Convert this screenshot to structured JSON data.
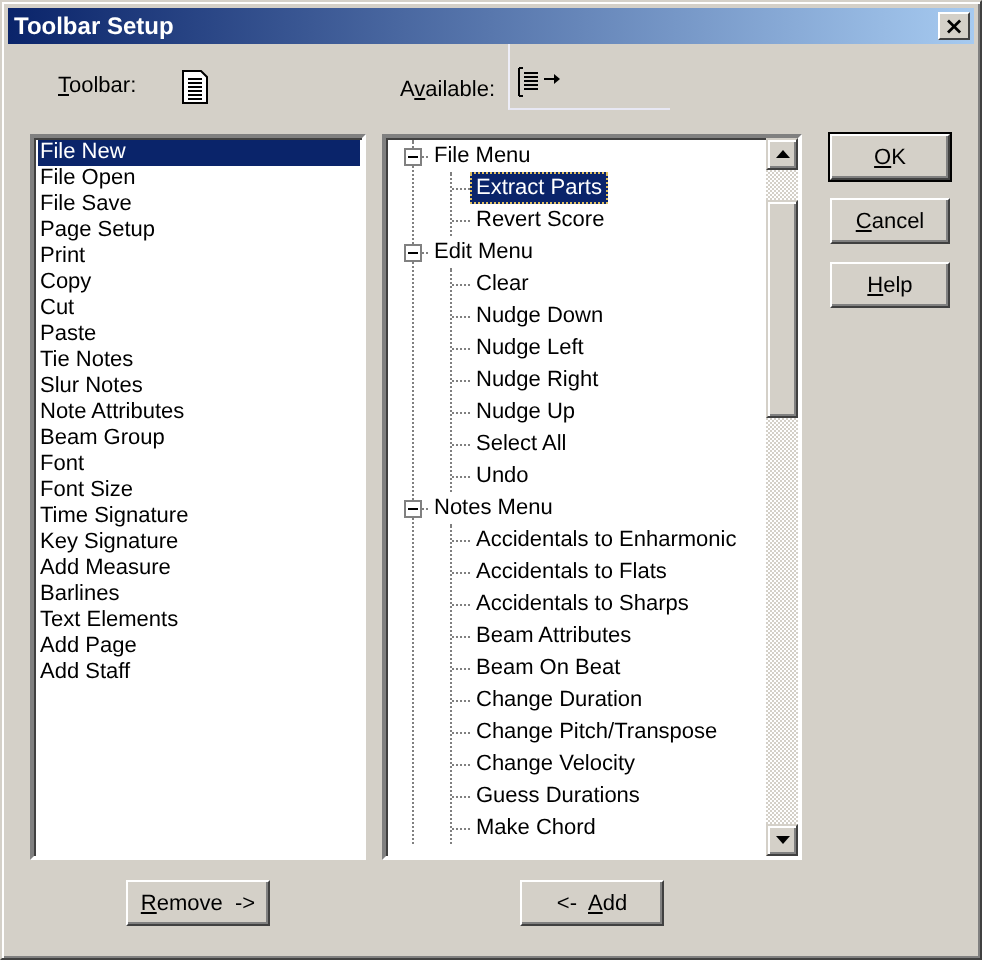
{
  "window": {
    "title": "Toolbar Setup",
    "close": "×"
  },
  "toolbar_label": {
    "key": "T",
    "post": "oolbar:"
  },
  "available_label": {
    "pre": "A",
    "key": "v",
    "post": "ailable:"
  },
  "toolbar_items": [
    {
      "label": "File New",
      "selected": true
    },
    {
      "label": "File Open",
      "selected": false
    },
    {
      "label": "File Save",
      "selected": false
    },
    {
      "label": "Page Setup",
      "selected": false
    },
    {
      "label": "Print",
      "selected": false
    },
    {
      "label": "Copy",
      "selected": false
    },
    {
      "label": "Cut",
      "selected": false
    },
    {
      "label": "Paste",
      "selected": false
    },
    {
      "label": "Tie Notes",
      "selected": false
    },
    {
      "label": "Slur Notes",
      "selected": false
    },
    {
      "label": "Note Attributes",
      "selected": false
    },
    {
      "label": "Beam Group",
      "selected": false
    },
    {
      "label": "Font",
      "selected": false
    },
    {
      "label": "Font Size",
      "selected": false
    },
    {
      "label": "Time Signature",
      "selected": false
    },
    {
      "label": "Key Signature",
      "selected": false
    },
    {
      "label": "Add Measure",
      "selected": false
    },
    {
      "label": "Barlines",
      "selected": false
    },
    {
      "label": "Text Elements",
      "selected": false
    },
    {
      "label": "Add Page",
      "selected": false
    },
    {
      "label": "Add Staff",
      "selected": false
    }
  ],
  "available_tree": [
    {
      "label": "File Menu",
      "expanded": true,
      "children": [
        {
          "label": "Extract Parts",
          "selected": true
        },
        {
          "label": "Revert Score",
          "selected": false
        }
      ]
    },
    {
      "label": "Edit Menu",
      "expanded": true,
      "children": [
        {
          "label": "Clear",
          "selected": false
        },
        {
          "label": "Nudge Down",
          "selected": false
        },
        {
          "label": "Nudge Left",
          "selected": false
        },
        {
          "label": "Nudge Right",
          "selected": false
        },
        {
          "label": "Nudge Up",
          "selected": false
        },
        {
          "label": "Select All",
          "selected": false
        },
        {
          "label": "Undo",
          "selected": false
        }
      ]
    },
    {
      "label": "Notes Menu",
      "expanded": true,
      "children": [
        {
          "label": "Accidentals to Enharmonic",
          "selected": false
        },
        {
          "label": "Accidentals to Flats",
          "selected": false
        },
        {
          "label": "Accidentals to Sharps",
          "selected": false
        },
        {
          "label": "Beam Attributes",
          "selected": false
        },
        {
          "label": "Beam On Beat",
          "selected": false
        },
        {
          "label": "Change Duration",
          "selected": false
        },
        {
          "label": "Change Pitch/Transpose",
          "selected": false
        },
        {
          "label": "Change Velocity",
          "selected": false
        },
        {
          "label": "Guess Durations",
          "selected": false
        },
        {
          "label": "Make Chord",
          "selected": false
        }
      ]
    }
  ],
  "side_buttons": [
    {
      "key": "O",
      "post": "K",
      "default": true
    },
    {
      "key": "C",
      "post": "ancel",
      "default": false
    },
    {
      "key": "H",
      "post": "elp",
      "default": false
    }
  ],
  "remove_button": {
    "key": "R",
    "post": "emove  ->"
  },
  "add_button": {
    "pre": "<-  ",
    "key": "A",
    "post": "dd"
  }
}
